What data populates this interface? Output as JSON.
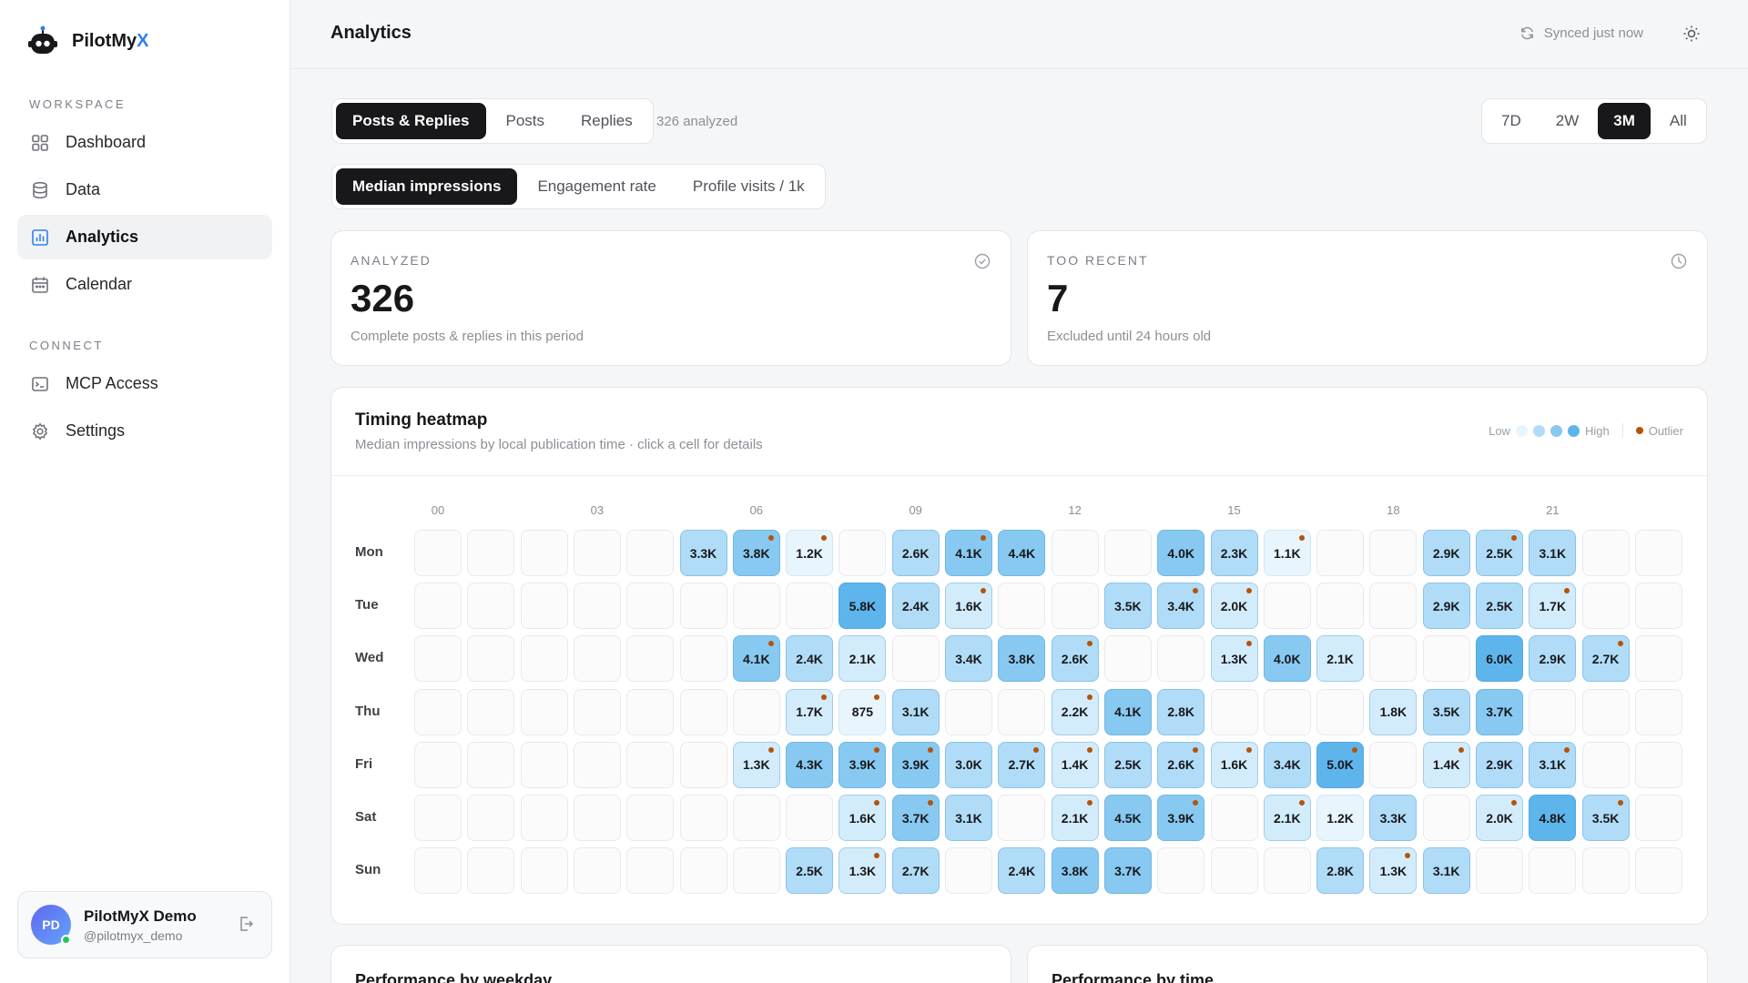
{
  "brand": {
    "name_prefix": "PilotMy",
    "name_suffix": "X"
  },
  "sidebar": {
    "workspace_label": "WORKSPACE",
    "workspace_items": [
      {
        "label": "Dashboard",
        "icon": "grid-icon"
      },
      {
        "label": "Data",
        "icon": "database-icon"
      },
      {
        "label": "Analytics",
        "icon": "bar-chart-icon",
        "active": true
      },
      {
        "label": "Calendar",
        "icon": "calendar-icon"
      }
    ],
    "connect_label": "CONNECT",
    "connect_items": [
      {
        "label": "MCP Access",
        "icon": "terminal-icon"
      },
      {
        "label": "Settings",
        "icon": "gear-icon"
      }
    ],
    "user": {
      "initials": "PD",
      "name": "PilotMyX Demo",
      "handle": "@pilotmyx_demo"
    }
  },
  "header": {
    "title": "Analytics",
    "sync_status": "Synced just now"
  },
  "filters": {
    "content_types": [
      "Posts & Replies",
      "Posts",
      "Replies"
    ],
    "content_selected": "Posts & Replies",
    "analyzed_note": "326 analyzed",
    "ranges": [
      "7D",
      "2W",
      "3M",
      "All"
    ],
    "range_selected": "3M",
    "metrics": [
      "Median impressions",
      "Engagement rate",
      "Profile visits / 1k"
    ],
    "metric_selected": "Median impressions"
  },
  "stats": {
    "analyzed": {
      "label": "ANALYZED",
      "value": "326",
      "sub": "Complete posts & replies in this period"
    },
    "too_recent": {
      "label": "TOO RECENT",
      "value": "7",
      "sub": "Excluded until 24 hours old"
    }
  },
  "heatmap": {
    "title": "Timing heatmap",
    "subtitle": "Median impressions by local publication time · click a cell for details",
    "legend": {
      "low": "Low",
      "high": "High",
      "outlier": "Outlier"
    },
    "colors": {
      "empty": "#fbfbfc",
      "level1": "#e8f5fd",
      "level2": "#d3ecfb",
      "level3": "#b0dcf7",
      "level4": "#87c9f1",
      "level5": "#5db5ec",
      "outlier": "#b45309"
    },
    "hour_labels": [
      "00",
      "03",
      "06",
      "09",
      "12",
      "15",
      "18",
      "21"
    ],
    "days": [
      {
        "day": "Mon",
        "cells": [
          {
            "h": 5,
            "v": "3.3K"
          },
          {
            "h": 6,
            "v": "3.8K",
            "o": true
          },
          {
            "h": 7,
            "v": "1.2K",
            "o": true
          },
          {
            "h": 9,
            "v": "2.6K"
          },
          {
            "h": 10,
            "v": "4.1K",
            "o": true
          },
          {
            "h": 11,
            "v": "4.4K"
          },
          {
            "h": 14,
            "v": "4.0K"
          },
          {
            "h": 15,
            "v": "2.3K"
          },
          {
            "h": 16,
            "v": "1.1K",
            "o": true
          },
          {
            "h": 19,
            "v": "2.9K"
          },
          {
            "h": 20,
            "v": "2.5K",
            "o": true
          },
          {
            "h": 21,
            "v": "3.1K"
          }
        ]
      },
      {
        "day": "Tue",
        "cells": [
          {
            "h": 8,
            "v": "5.8K"
          },
          {
            "h": 9,
            "v": "2.4K"
          },
          {
            "h": 10,
            "v": "1.6K",
            "o": true
          },
          {
            "h": 13,
            "v": "3.5K"
          },
          {
            "h": 14,
            "v": "3.4K",
            "o": true
          },
          {
            "h": 15,
            "v": "2.0K",
            "o": true
          },
          {
            "h": 19,
            "v": "2.9K"
          },
          {
            "h": 20,
            "v": "2.5K"
          },
          {
            "h": 21,
            "v": "1.7K",
            "o": true
          }
        ]
      },
      {
        "day": "Wed",
        "cells": [
          {
            "h": 6,
            "v": "4.1K",
            "o": true
          },
          {
            "h": 7,
            "v": "2.4K"
          },
          {
            "h": 8,
            "v": "2.1K"
          },
          {
            "h": 10,
            "v": "3.4K"
          },
          {
            "h": 11,
            "v": "3.8K"
          },
          {
            "h": 12,
            "v": "2.6K",
            "o": true
          },
          {
            "h": 15,
            "v": "1.3K",
            "o": true
          },
          {
            "h": 16,
            "v": "4.0K"
          },
          {
            "h": 17,
            "v": "2.1K"
          },
          {
            "h": 20,
            "v": "6.0K"
          },
          {
            "h": 21,
            "v": "2.9K"
          },
          {
            "h": 22,
            "v": "2.7K",
            "o": true
          }
        ]
      },
      {
        "day": "Thu",
        "cells": [
          {
            "h": 7,
            "v": "1.7K",
            "o": true
          },
          {
            "h": 8,
            "v": "875",
            "o": true
          },
          {
            "h": 9,
            "v": "3.1K"
          },
          {
            "h": 12,
            "v": "2.2K",
            "o": true
          },
          {
            "h": 13,
            "v": "4.1K"
          },
          {
            "h": 14,
            "v": "2.8K"
          },
          {
            "h": 18,
            "v": "1.8K"
          },
          {
            "h": 19,
            "v": "3.5K"
          },
          {
            "h": 20,
            "v": "3.7K"
          }
        ]
      },
      {
        "day": "Fri",
        "cells": [
          {
            "h": 6,
            "v": "1.3K",
            "o": true
          },
          {
            "h": 7,
            "v": "4.3K"
          },
          {
            "h": 8,
            "v": "3.9K",
            "o": true
          },
          {
            "h": 9,
            "v": "3.9K",
            "o": true
          },
          {
            "h": 10,
            "v": "3.0K"
          },
          {
            "h": 11,
            "v": "2.7K",
            "o": true
          },
          {
            "h": 12,
            "v": "1.4K",
            "o": true
          },
          {
            "h": 13,
            "v": "2.5K"
          },
          {
            "h": 14,
            "v": "2.6K",
            "o": true
          },
          {
            "h": 15,
            "v": "1.6K",
            "o": true
          },
          {
            "h": 16,
            "v": "3.4K"
          },
          {
            "h": 17,
            "v": "5.0K",
            "o": true
          },
          {
            "h": 19,
            "v": "1.4K",
            "o": true
          },
          {
            "h": 20,
            "v": "2.9K"
          },
          {
            "h": 21,
            "v": "3.1K",
            "o": true
          }
        ]
      },
      {
        "day": "Sat",
        "cells": [
          {
            "h": 8,
            "v": "1.6K",
            "o": true
          },
          {
            "h": 9,
            "v": "3.7K",
            "o": true
          },
          {
            "h": 10,
            "v": "3.1K"
          },
          {
            "h": 12,
            "v": "2.1K",
            "o": true
          },
          {
            "h": 13,
            "v": "4.5K"
          },
          {
            "h": 14,
            "v": "3.9K",
            "o": true
          },
          {
            "h": 16,
            "v": "2.1K",
            "o": true
          },
          {
            "h": 17,
            "v": "1.2K"
          },
          {
            "h": 18,
            "v": "3.3K"
          },
          {
            "h": 20,
            "v": "2.0K",
            "o": true
          },
          {
            "h": 21,
            "v": "4.8K"
          },
          {
            "h": 22,
            "v": "3.5K",
            "o": true
          }
        ]
      },
      {
        "day": "Sun",
        "cells": [
          {
            "h": 7,
            "v": "2.5K"
          },
          {
            "h": 8,
            "v": "1.3K",
            "o": true
          },
          {
            "h": 9,
            "v": "2.7K"
          },
          {
            "h": 11,
            "v": "2.4K"
          },
          {
            "h": 12,
            "v": "3.8K"
          },
          {
            "h": 13,
            "v": "3.7K"
          },
          {
            "h": 17,
            "v": "2.8K"
          },
          {
            "h": 18,
            "v": "1.3K",
            "o": true
          },
          {
            "h": 19,
            "v": "3.1K"
          }
        ]
      }
    ]
  },
  "bottom_cards": {
    "weekday_title": "Performance by weekday",
    "time_title": "Performance by time"
  }
}
